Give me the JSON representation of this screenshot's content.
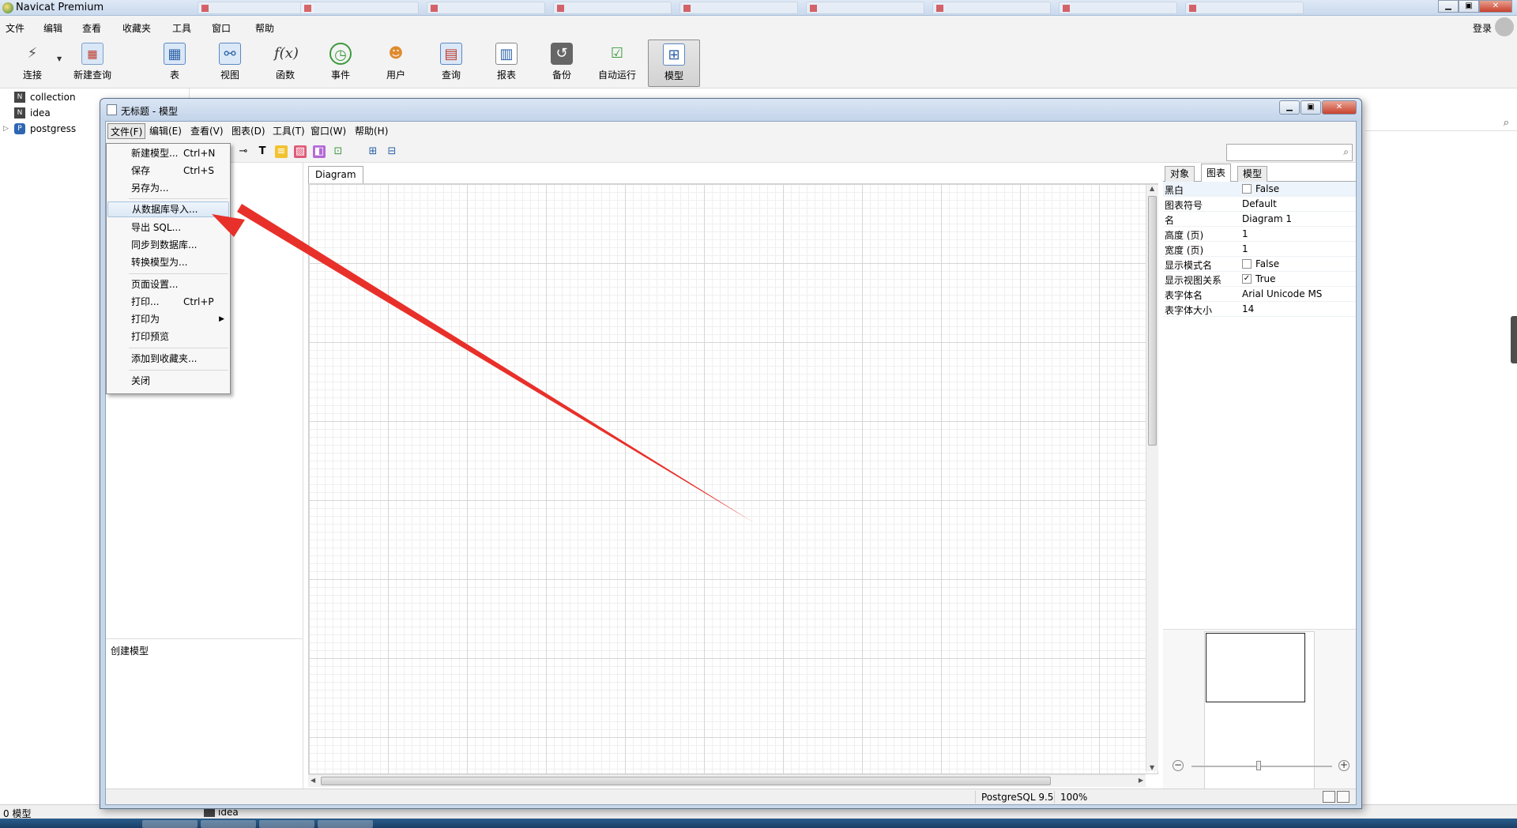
{
  "main_window": {
    "title": "Navicat Premium",
    "menu": [
      "文件",
      "编辑",
      "查看",
      "收藏夹",
      "工具",
      "窗口",
      "帮助"
    ],
    "login": "登录",
    "toolbar": [
      {
        "label": "连接",
        "icon": "plug-icon"
      },
      {
        "label": "新建查询",
        "icon": "new-query-icon"
      },
      {
        "label": "表",
        "icon": "table-icon"
      },
      {
        "label": "视图",
        "icon": "view-icon"
      },
      {
        "label": "函数",
        "icon": "function-icon"
      },
      {
        "label": "事件",
        "icon": "clock-icon"
      },
      {
        "label": "用户",
        "icon": "user-icon"
      },
      {
        "label": "查询",
        "icon": "query-icon"
      },
      {
        "label": "报表",
        "icon": "report-icon"
      },
      {
        "label": "备份",
        "icon": "backup-icon"
      },
      {
        "label": "自动运行",
        "icon": "schedule-icon"
      },
      {
        "label": "模型",
        "icon": "model-icon"
      }
    ],
    "connections": [
      {
        "name": "collection",
        "icon": "navicat-connection-icon"
      },
      {
        "name": "idea",
        "icon": "navicat-connection-icon"
      },
      {
        "name": "postgress",
        "icon": "postgresql-icon"
      }
    ],
    "status_left": "0 模型",
    "status_item": "idea"
  },
  "model_window": {
    "title": "无标题 - 模型",
    "menu": [
      "文件(F)",
      "编辑(E)",
      "查看(V)",
      "图表(D)",
      "工具(T)",
      "窗口(W)",
      "帮助(H)"
    ],
    "diagram_tab": "Diagram 1",
    "left_description": "创建模型",
    "property_tabs": [
      "对象",
      "图表",
      "模型"
    ],
    "active_property_tab": "图表",
    "properties": [
      {
        "name": "黑白",
        "value": "False",
        "checkbox": true,
        "checked": false
      },
      {
        "name": "图表符号",
        "value": "Default"
      },
      {
        "name": "名",
        "value": "Diagram 1"
      },
      {
        "name": "高度 (页)",
        "value": "1"
      },
      {
        "name": "宽度 (页)",
        "value": "1"
      },
      {
        "name": "显示模式名",
        "value": "False",
        "checkbox": true,
        "checked": false
      },
      {
        "name": "显示视图关系",
        "value": "True",
        "checkbox": true,
        "checked": true
      },
      {
        "name": "表字体名",
        "value": "Arial Unicode MS"
      },
      {
        "name": "表字体大小",
        "value": "14"
      }
    ],
    "status_db": "PostgreSQL 9.5",
    "status_zoom": "100%"
  },
  "file_menu": {
    "items": [
      {
        "label": "新建模型...",
        "shortcut": "Ctrl+N"
      },
      {
        "label": "保存",
        "shortcut": "Ctrl+S"
      },
      {
        "label": "另存为..."
      },
      {
        "label": "从数据库导入...",
        "highlighted": true
      },
      {
        "label": "导出 SQL..."
      },
      {
        "label": "同步到数据库..."
      },
      {
        "label": "转换模型为..."
      },
      {
        "label": "页面设置..."
      },
      {
        "label": "打印...",
        "shortcut": "Ctrl+P"
      },
      {
        "label": "打印为",
        "submenu": true
      },
      {
        "label": "打印预览"
      },
      {
        "label": "添加到收藏夹..."
      },
      {
        "label": "关闭"
      }
    ]
  },
  "annotation": {
    "arrow_color": "#e8302a"
  }
}
